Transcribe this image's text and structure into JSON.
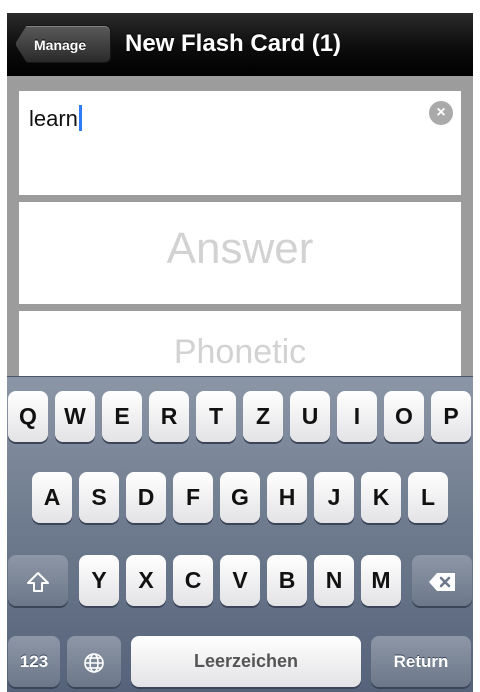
{
  "navbar": {
    "back_label": "Manage",
    "title": "New Flash Card (1)"
  },
  "fields": {
    "question_value": "learn",
    "clear_icon": "clear-circle-x",
    "answer_placeholder": "Answer",
    "phonetic_placeholder": "Phonetic"
  },
  "keyboard": {
    "row1": [
      "Q",
      "W",
      "E",
      "R",
      "T",
      "Z",
      "U",
      "I",
      "O",
      "P"
    ],
    "row2": [
      "A",
      "S",
      "D",
      "F",
      "G",
      "H",
      "J",
      "K",
      "L"
    ],
    "row3": [
      "Y",
      "X",
      "C",
      "V",
      "B",
      "N",
      "M"
    ],
    "shift_icon": "shift-arrow",
    "delete_icon": "delete-backspace",
    "numbers_label": "123",
    "globe_icon": "globe",
    "space_label": "Leerzeichen",
    "return_label": "Return"
  },
  "colors": {
    "caret": "#2f7cf6",
    "navbar": "#0d0d0d",
    "keyboard_bg": "#6f7c8f"
  }
}
